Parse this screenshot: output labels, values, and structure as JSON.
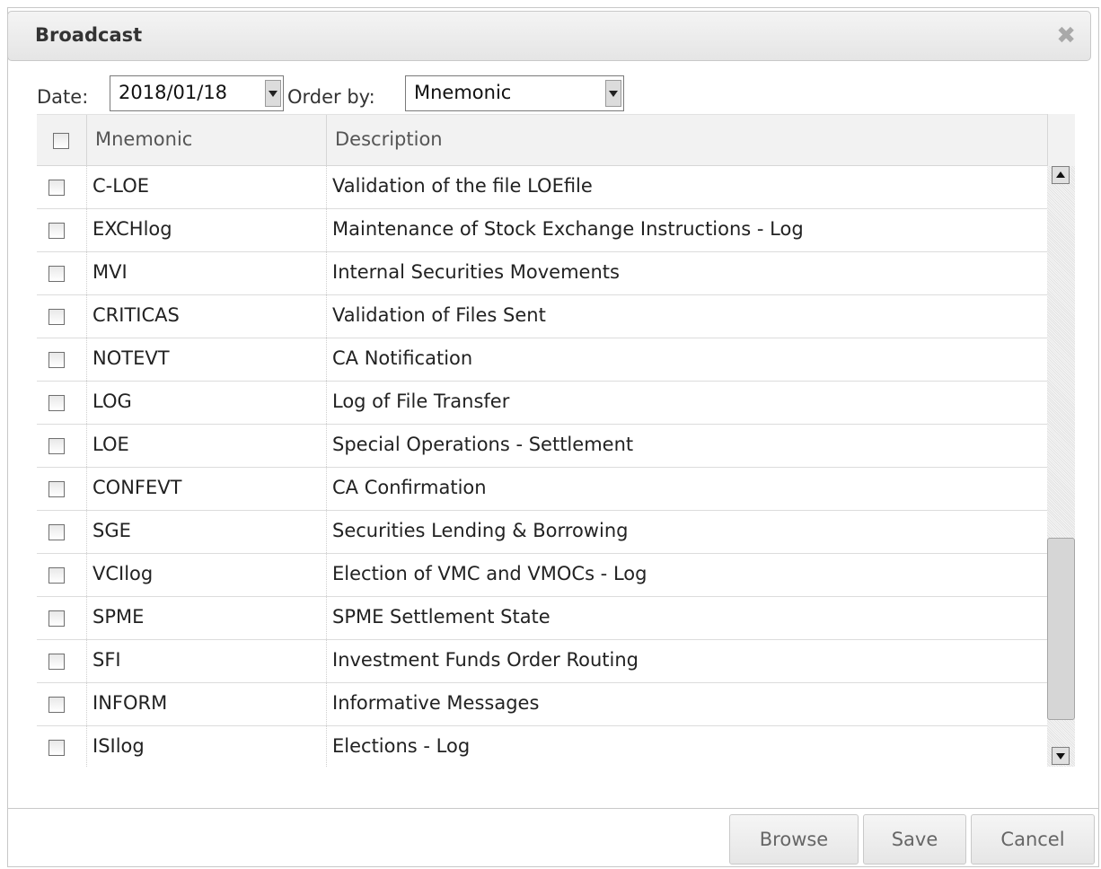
{
  "dialog": {
    "title": "Broadcast",
    "close_glyph": "✖",
    "close_icon": "close-icon"
  },
  "filters": {
    "date_label": "Date:",
    "date_value": "2018/01/18",
    "order_label": "Order by:",
    "order_value": "Mnemonic"
  },
  "table": {
    "columns": [
      "Mnemonic",
      "Description"
    ],
    "rows": [
      {
        "mnemonic": "C-LOE",
        "description": "Validation of the file LOEfile"
      },
      {
        "mnemonic": "EXCHlog",
        "description": "Maintenance of Stock Exchange Instructions - Log"
      },
      {
        "mnemonic": "MVI",
        "description": "Internal Securities Movements"
      },
      {
        "mnemonic": "CRITICAS",
        "description": "Validation of Files Sent"
      },
      {
        "mnemonic": "NOTEVT",
        "description": "CA Notification"
      },
      {
        "mnemonic": "LOG",
        "description": "Log of File Transfer"
      },
      {
        "mnemonic": "LOE",
        "description": "Special Operations - Settlement"
      },
      {
        "mnemonic": "CONFEVT",
        "description": "CA Confirmation"
      },
      {
        "mnemonic": "SGE",
        "description": "Securities Lending & Borrowing"
      },
      {
        "mnemonic": "VCIlog",
        "description": "Election of VMC and VMOCs - Log"
      },
      {
        "mnemonic": "SPME",
        "description": "SPME Settlement State"
      },
      {
        "mnemonic": "SFI",
        "description": "Investment Funds Order Routing"
      },
      {
        "mnemonic": "INFORM",
        "description": "Informative Messages"
      },
      {
        "mnemonic": "ISIlog",
        "description": "Elections - Log"
      }
    ]
  },
  "buttons": {
    "browse": "Browse",
    "save": "Save",
    "cancel": "Cancel"
  }
}
